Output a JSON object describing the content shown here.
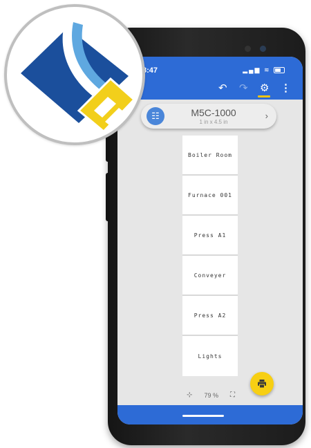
{
  "status_bar": {
    "time": "8:47",
    "signal": "▂▄▆",
    "wifi": "≋"
  },
  "toolbar": {
    "undo_icon": "undo-icon",
    "redo_icon": "redo-icon",
    "settings_icon": "gear-icon",
    "more_icon": "more-vert-icon",
    "undo_glyph": "↶",
    "redo_glyph": "↷",
    "gear_glyph": "⚙",
    "more_glyph": "⋮"
  },
  "printer": {
    "model": "M5C-1000",
    "size": "1 in x 4.5 in",
    "settings_glyph": "☷",
    "chevron_glyph": "›"
  },
  "labels": [
    "Boiler Room",
    "Furnace 001",
    "Press A1",
    "Conveyer",
    "Press A2",
    "Lights"
  ],
  "zoom": {
    "level": "79 %",
    "zoom_out_glyph": "⊹",
    "zoom_in_glyph": "⛶"
  },
  "colors": {
    "primary": "#2d6bd6",
    "accent": "#f7cf13",
    "logo_dark_blue": "#1b4f9c",
    "logo_light_blue": "#5fa8e0",
    "logo_yellow": "#f2cf1b"
  }
}
